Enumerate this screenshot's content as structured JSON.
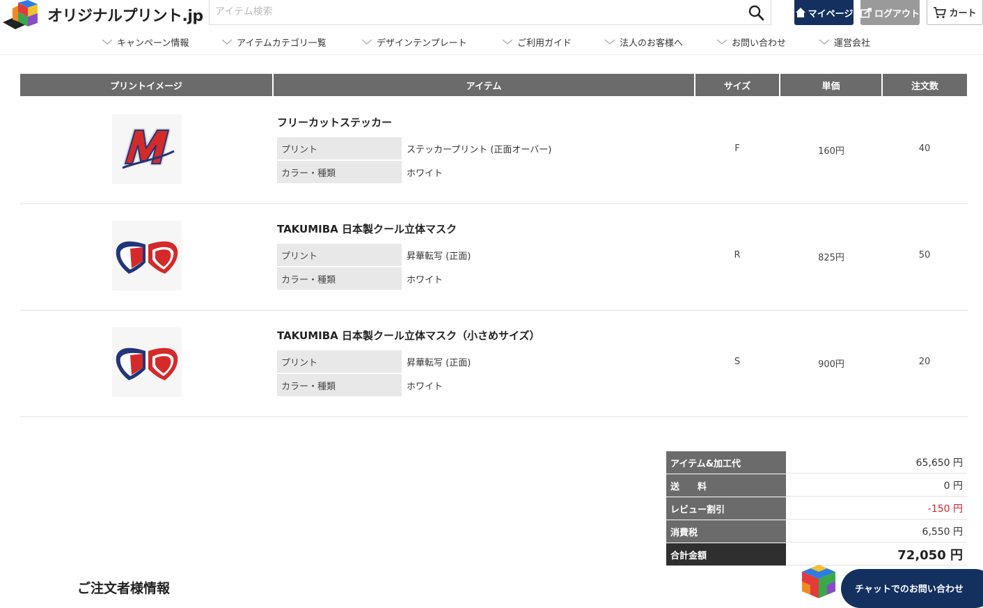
{
  "brand": {
    "logo_text": "オリジナルプリント.jp"
  },
  "search": {
    "placeholder": "アイテム検索"
  },
  "header_buttons": {
    "mypage": "マイページ",
    "logout": "ログアウト",
    "cart": "カート"
  },
  "nav": [
    {
      "label": "キャンペーン情報"
    },
    {
      "label": "アイテムカテゴリ一覧"
    },
    {
      "label": "デザインテンプレート"
    },
    {
      "label": "ご利用ガイド"
    },
    {
      "label": "法人のお客様へ"
    },
    {
      "label": "お問い合わせ"
    },
    {
      "label": "運営会社"
    }
  ],
  "table": {
    "headers": {
      "image": "プリントイメージ",
      "item": "アイテム",
      "size": "サイズ",
      "unit_price": "単価",
      "quantity": "注文数"
    },
    "rows": [
      {
        "name": "フリーカットステッカー",
        "print_label": "プリント",
        "print_value": "ステッカープリント (正面オーバー)",
        "color_label": "カラー・種類",
        "color_value": "ホワイト",
        "size": "F",
        "unit_price": "160円",
        "quantity": "40"
      },
      {
        "name": "TAKUMIBA 日本製クール立体マスク",
        "print_label": "プリント",
        "print_value": "昇華転写 (正面)",
        "color_label": "カラー・種類",
        "color_value": "ホワイト",
        "size": "R",
        "unit_price": "825円",
        "quantity": "50"
      },
      {
        "name": "TAKUMIBA 日本製クール立体マスク（小さめサイズ）",
        "print_label": "プリント",
        "print_value": "昇華転写 (正面)",
        "color_label": "カラー・種類",
        "color_value": "ホワイト",
        "size": "S",
        "unit_price": "900円",
        "quantity": "20"
      }
    ]
  },
  "totals": {
    "items_processing_label": "アイテム&加工代",
    "items_processing_value": "65,650 円",
    "shipping_label": "送　　料",
    "shipping_value": "0 円",
    "review_discount_label": "レビュー割引",
    "review_discount_value": "-150 円",
    "tax_label": "消費税",
    "tax_value": "6,550 円",
    "total_label": "合計金額",
    "total_value": "72,050 円"
  },
  "orderer_section_title": "ご注文者様情報",
  "chat": {
    "label": "チャットでのお問い合わせ"
  },
  "colors": {
    "navy": "#13305f",
    "header_gray": "#6b6b6b",
    "total_dark": "#2f2f2f",
    "discount_red": "#d0202e",
    "sticker_red": "#d42a2a",
    "mask_blue": "#23357a"
  }
}
